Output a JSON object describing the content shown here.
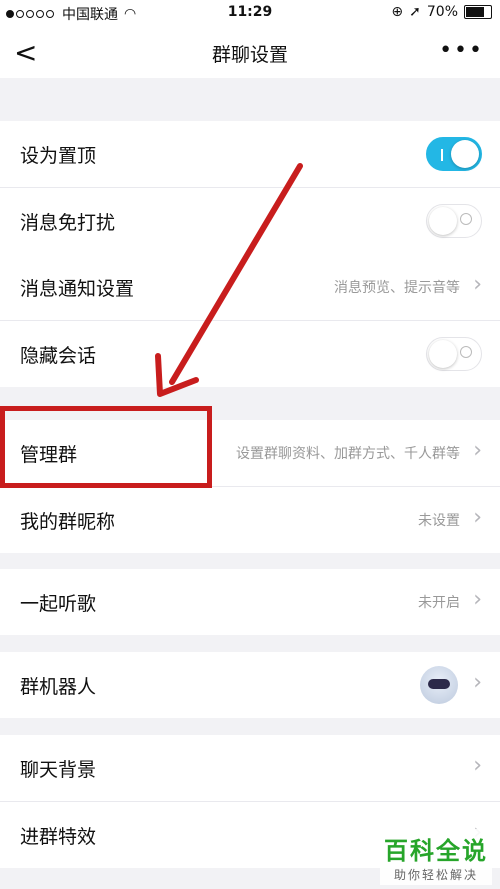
{
  "status_bar": {
    "carrier": "中国联通",
    "time": "11:29",
    "battery": "70%"
  },
  "navbar": {
    "back_symbol": "<",
    "title": "群聊设置",
    "more_symbol": "•••"
  },
  "groups": [
    [
      {
        "label": "设为置顶",
        "type": "toggle",
        "on": true
      },
      {
        "label": "消息免打扰",
        "type": "toggle",
        "on": false
      }
    ],
    [
      {
        "label": "消息通知设置",
        "type": "link",
        "value": "消息预览、提示音等"
      },
      {
        "label": "隐藏会话",
        "type": "toggle",
        "on": false
      }
    ],
    [
      {
        "label": "管理群",
        "type": "link",
        "value": "设置群聊资料、加群方式、千人群等"
      },
      {
        "label": "我的群昵称",
        "type": "link",
        "value": "未设置"
      }
    ],
    [
      {
        "label": "一起听歌",
        "type": "link",
        "value": "未开启"
      }
    ],
    [
      {
        "label": "群机器人",
        "type": "link",
        "value": "",
        "icon": "robot-avatar-icon"
      }
    ],
    [
      {
        "label": "聊天背景",
        "type": "link",
        "value": ""
      },
      {
        "label": "进群特效",
        "type": "link",
        "value": ""
      }
    ]
  ],
  "watermark": {
    "title": "百科全说",
    "subtitle": "助你轻松解决"
  },
  "colors": {
    "toggle_on": "#23b7e5",
    "annotation": "#c81d1d",
    "watermark": "#27a52a"
  }
}
